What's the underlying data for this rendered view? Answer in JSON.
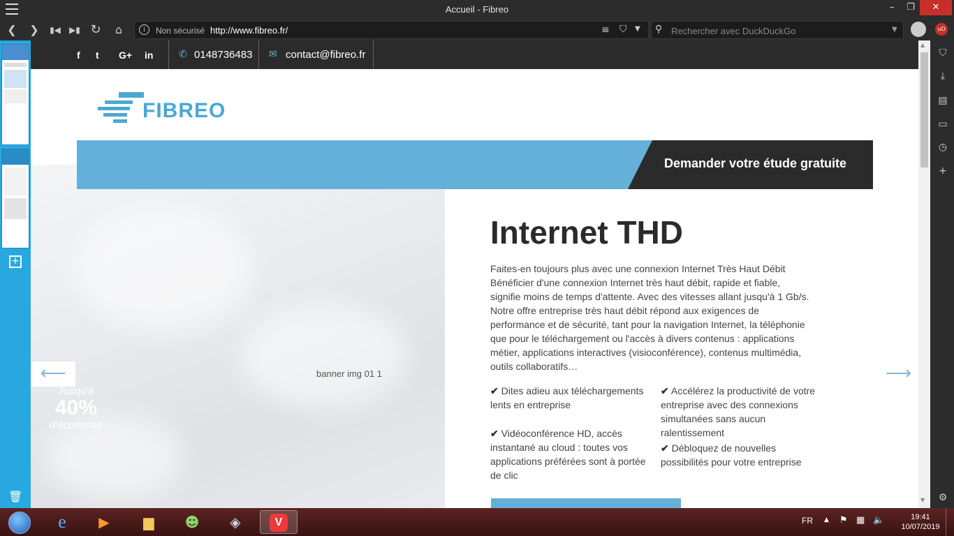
{
  "window": {
    "title": "Accueil - Fibreo",
    "minimize": "–",
    "maximize": "❐",
    "close": "✕"
  },
  "navbar": {
    "url_insecure": "Non sécurisé",
    "url": "http://www.fibreo.fr/",
    "search_placeholder": "Rechercher avec DuckDuckGo"
  },
  "site": {
    "topbar": {
      "social": [
        "f",
        "t",
        "G+",
        "in"
      ],
      "phone": "0148736483",
      "email": "contact@fibreo.fr"
    },
    "logo": "FIBREO",
    "cta": "Demander votre étude gratuite",
    "banner_alt": "banner img 01 1",
    "promo": {
      "line1": "Jusqu'à",
      "line2": "40%",
      "line3": "d'économie"
    },
    "arrows": {
      "prev": "⟵",
      "next": "⟶"
    },
    "title": "Internet THD",
    "description": "Faites-en toujours plus avec une connexion Internet Très Haut Débit Bénéficier d'une connexion Internet très haut débit, rapide et fiable, signifie moins de temps d'attente. Avec des vitesses allant jusqu'à 1 Gb/s. Notre offre entreprise très haut débit répond aux exigences de performance et de sécurité, tant pour la navigation Internet, la téléphonie que pour le téléchargement ou l'accès à divers contenus : applications métier, applications interactives (visioconférence), contenus multimédia, outils collaboratifs…",
    "features": [
      "Dites adieu aux téléchargements lents en entreprise",
      "Vidéoconférence HD, accès instantané au cloud : toutes vos applications préférées sont à portée de clic",
      "Accélérez la productivité de votre entreprise avec des connexions simultanées sans aucun ralentissement",
      "Débloquez de nouvelles possibilités pour votre entreprise"
    ],
    "check": "✔"
  },
  "taskbar": {
    "lang": "FR",
    "time": "19:41",
    "date": "10/07/2019"
  },
  "colors": {
    "accent_blue": "#65b0d8",
    "dark": "#2b2b2b",
    "panel": "#29a8e0",
    "close": "#c7302a"
  }
}
